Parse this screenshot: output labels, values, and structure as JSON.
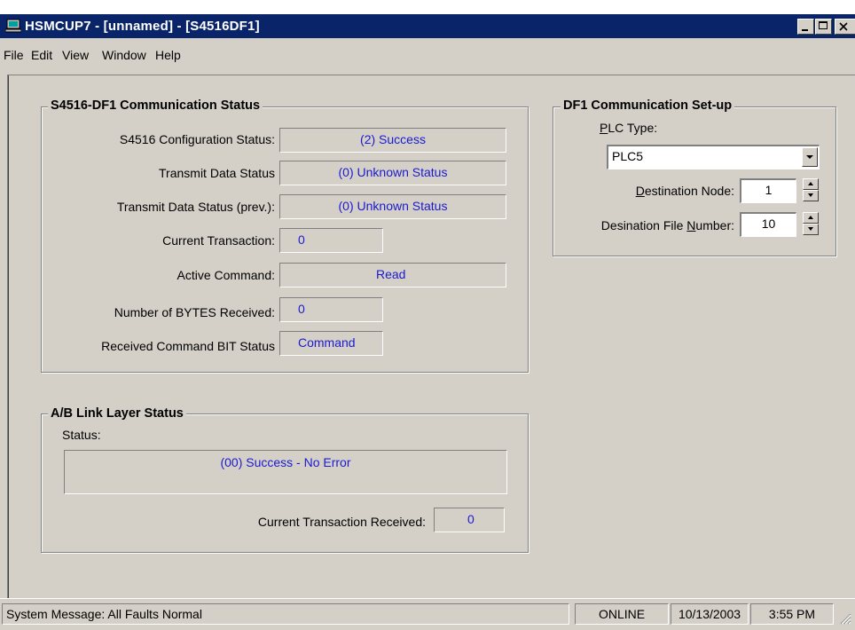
{
  "window": {
    "title": "HSMCUP7 - [unnamed] - [S4516DF1]",
    "min_icon": "minimize-icon",
    "max_icon": "maximize-icon",
    "close_icon": "close-icon"
  },
  "menu": [
    "File",
    "Edit",
    "View",
    "Window",
    "Help"
  ],
  "comm_status": {
    "title": "S4516-DF1 Communication Status",
    "config_label": "S4516 Configuration Status:",
    "config_value": "(2) Success",
    "tx_label": "Transmit Data Status",
    "tx_value": "(0) Unknown Status",
    "tx_prev_label": "Transmit Data Status (prev.):",
    "tx_prev_value": "(0) Unknown Status",
    "cur_tx_label": "Current Transaction:",
    "cur_tx_value": "0",
    "active_cmd_label": "Active Command:",
    "active_cmd_value": "Read",
    "bytes_label": "Number of BYTES Received:",
    "bytes_value": "0",
    "rcv_bit_label": "Received Command BIT Status",
    "rcv_bit_value": "Command"
  },
  "link_layer": {
    "title": "A/B Link Layer Status",
    "status_label": "Status:",
    "status_value": "(00) Success - No Error",
    "cur_tx_rcv_label": "Current Transaction Received:",
    "cur_tx_rcv_value": "0"
  },
  "setup": {
    "title": "DF1 Communication Set-up",
    "plc_type_label_accel": "P",
    "plc_type_label_rest": "LC Type:",
    "plc_type_value": "PLC5",
    "dest_node_label_accel": "D",
    "dest_node_label_rest": "estination Node:",
    "dest_node_value": "1",
    "dest_file_label_pre": "Desination File ",
    "dest_file_label_accel": "N",
    "dest_file_label_rest": "umber:",
    "dest_file_value": "10"
  },
  "statusbar": {
    "message": "System Message:  All Faults Normal",
    "mode": "ONLINE",
    "date": "10/13/2003",
    "time": "3:55 PM"
  },
  "colors": {
    "titlebar": "#0a246a",
    "face": "#d4d0c8",
    "value_text": "#1a1ad0"
  }
}
